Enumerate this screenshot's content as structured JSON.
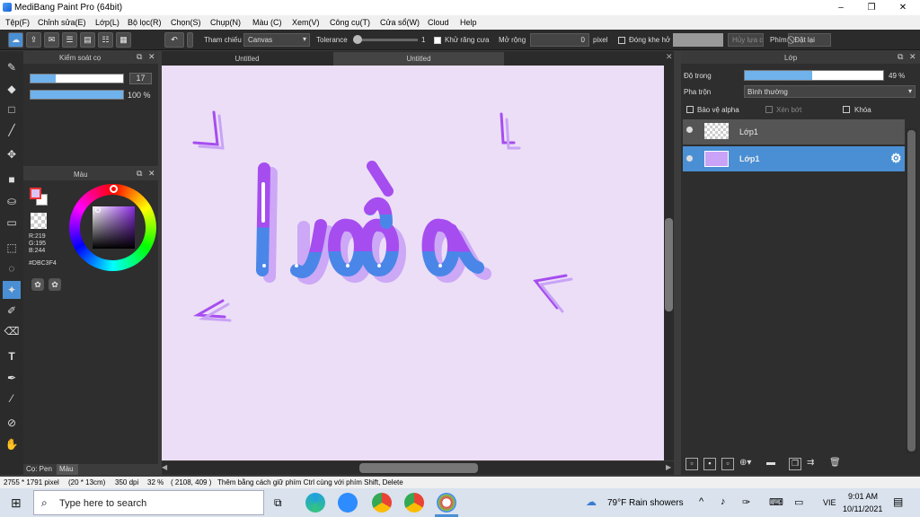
{
  "window": {
    "title": "MediBang Paint Pro (64bit)",
    "minimize": "–",
    "maximize": "❐",
    "close": "✕"
  },
  "menu": [
    "Tệp(F)",
    "Chỉnh sửa(E)",
    "Lớp(L)",
    "Bộ lọc(R)",
    "Chọn(S)",
    "Chụp(N)",
    "Màu (C)",
    "Xem(V)",
    "Công cụ(T)",
    "Cửa sổ(W)",
    "Cloud",
    "Help"
  ],
  "toolbar": {
    "ref_label": "Tham chiếu",
    "ref_value": "Canvas",
    "tolerance_label": "Tolerance",
    "tolerance_value": "1",
    "antialias_label": "Khử răng cưa",
    "expand_label": "Mở rộng",
    "expand_value": "0",
    "expand_unit": "pixel",
    "gap_label": "Đóng khe hở",
    "gap_value": "Hủy lựa chọn",
    "key_label": "Phím",
    "reset_label": "Đặt lại"
  },
  "brush_panel": {
    "title": "Kiểm soát cọ",
    "size": "17",
    "opacity": "100 %",
    "size_fill": 0.27,
    "opacity_fill": 1.0
  },
  "color_panel": {
    "title": "Màu",
    "r": "R:219",
    "g": "G:195",
    "b": "B:244",
    "hex": "#DBC3F4",
    "color": "#DBC3F4"
  },
  "tabs": [
    "Untitled",
    "Untitled"
  ],
  "layer_panel": {
    "title": "Lớp",
    "opacity_label": "Độ trong",
    "opacity_value": "49 %",
    "opacity_fill": 0.49,
    "blend_label": "Pha trộn",
    "blend_value": "Bình thường",
    "alpha_label": "Bảo vệ alpha",
    "clip_label": "Xén bớt",
    "lock_label": "Khóa",
    "layers": [
      {
        "name": "Lớp1"
      },
      {
        "name": "Lớp1"
      }
    ]
  },
  "side_tabs": {
    "brush": "Cọ: Pen",
    "color": "Màu"
  },
  "status": {
    "size": "2755 * 1791 pixel",
    "cm": "(20 * 13cm)",
    "dpi": "350 dpi",
    "zoom": "32 %",
    "coords": "( 2108, 409 )",
    "hint": "Thêm bằng cách giữ phím Ctrl cùng với phím Shift, Delete"
  },
  "taskbar": {
    "search": "Type here to search",
    "weather": "79°F  Rain showers",
    "lang": "VIE",
    "time": "9:01 AM",
    "date": "10/11/2021"
  },
  "colors": {
    "accent": "#4a8fd4",
    "purple": "#a64df0",
    "blue": "#4a86e8"
  }
}
